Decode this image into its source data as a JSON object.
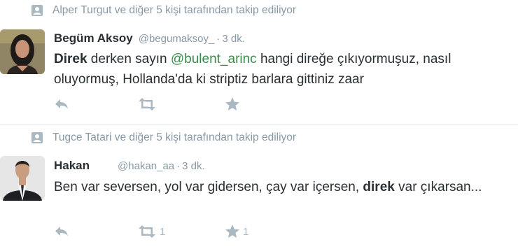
{
  "colors": {
    "muted": "#8899a6",
    "action": "#aab8c2",
    "mention": "#3b8a4b",
    "text": "#292f33",
    "context_icon": "#aab8c2"
  },
  "tweets": [
    {
      "context_icon": "user-follow-icon",
      "context": "Alper Turgut ve diğer 5 kişi tarafından takip ediliyor",
      "name": "Begüm Aksoy",
      "handle": "@begumaksoy_",
      "separator": "·",
      "time": "3 dk.",
      "text": {
        "kw": "Direk",
        "part1": " derken sayın ",
        "mention": "@bulent_arinc",
        "part2": " hangi direğe çıkıyormuşuz, nasıl oluyormuş, Hollanda'da ki striptiz barlara gittiniz zaar"
      },
      "actions": {
        "reply_icon": "reply-icon",
        "retweet_icon": "retweet-icon",
        "favorite_icon": "star-icon",
        "retweet_count": "",
        "favorite_count": ""
      }
    },
    {
      "context_icon": "user-follow-icon",
      "context": "Tugce Tatari ve diğer 5 kişi tarafından takip ediliyor",
      "name": "Hakan",
      "handle": "@hakan_aa",
      "separator": "·",
      "time": "3 dk.",
      "text": {
        "part1": "Ben var seversen, yol var gidersen, çay var içersen, ",
        "kw": "direk",
        "part2": " var çıkarsan..."
      },
      "actions": {
        "reply_icon": "reply-icon",
        "retweet_icon": "retweet-icon",
        "favorite_icon": "star-icon",
        "retweet_count": "1",
        "favorite_count": "1"
      }
    }
  ]
}
